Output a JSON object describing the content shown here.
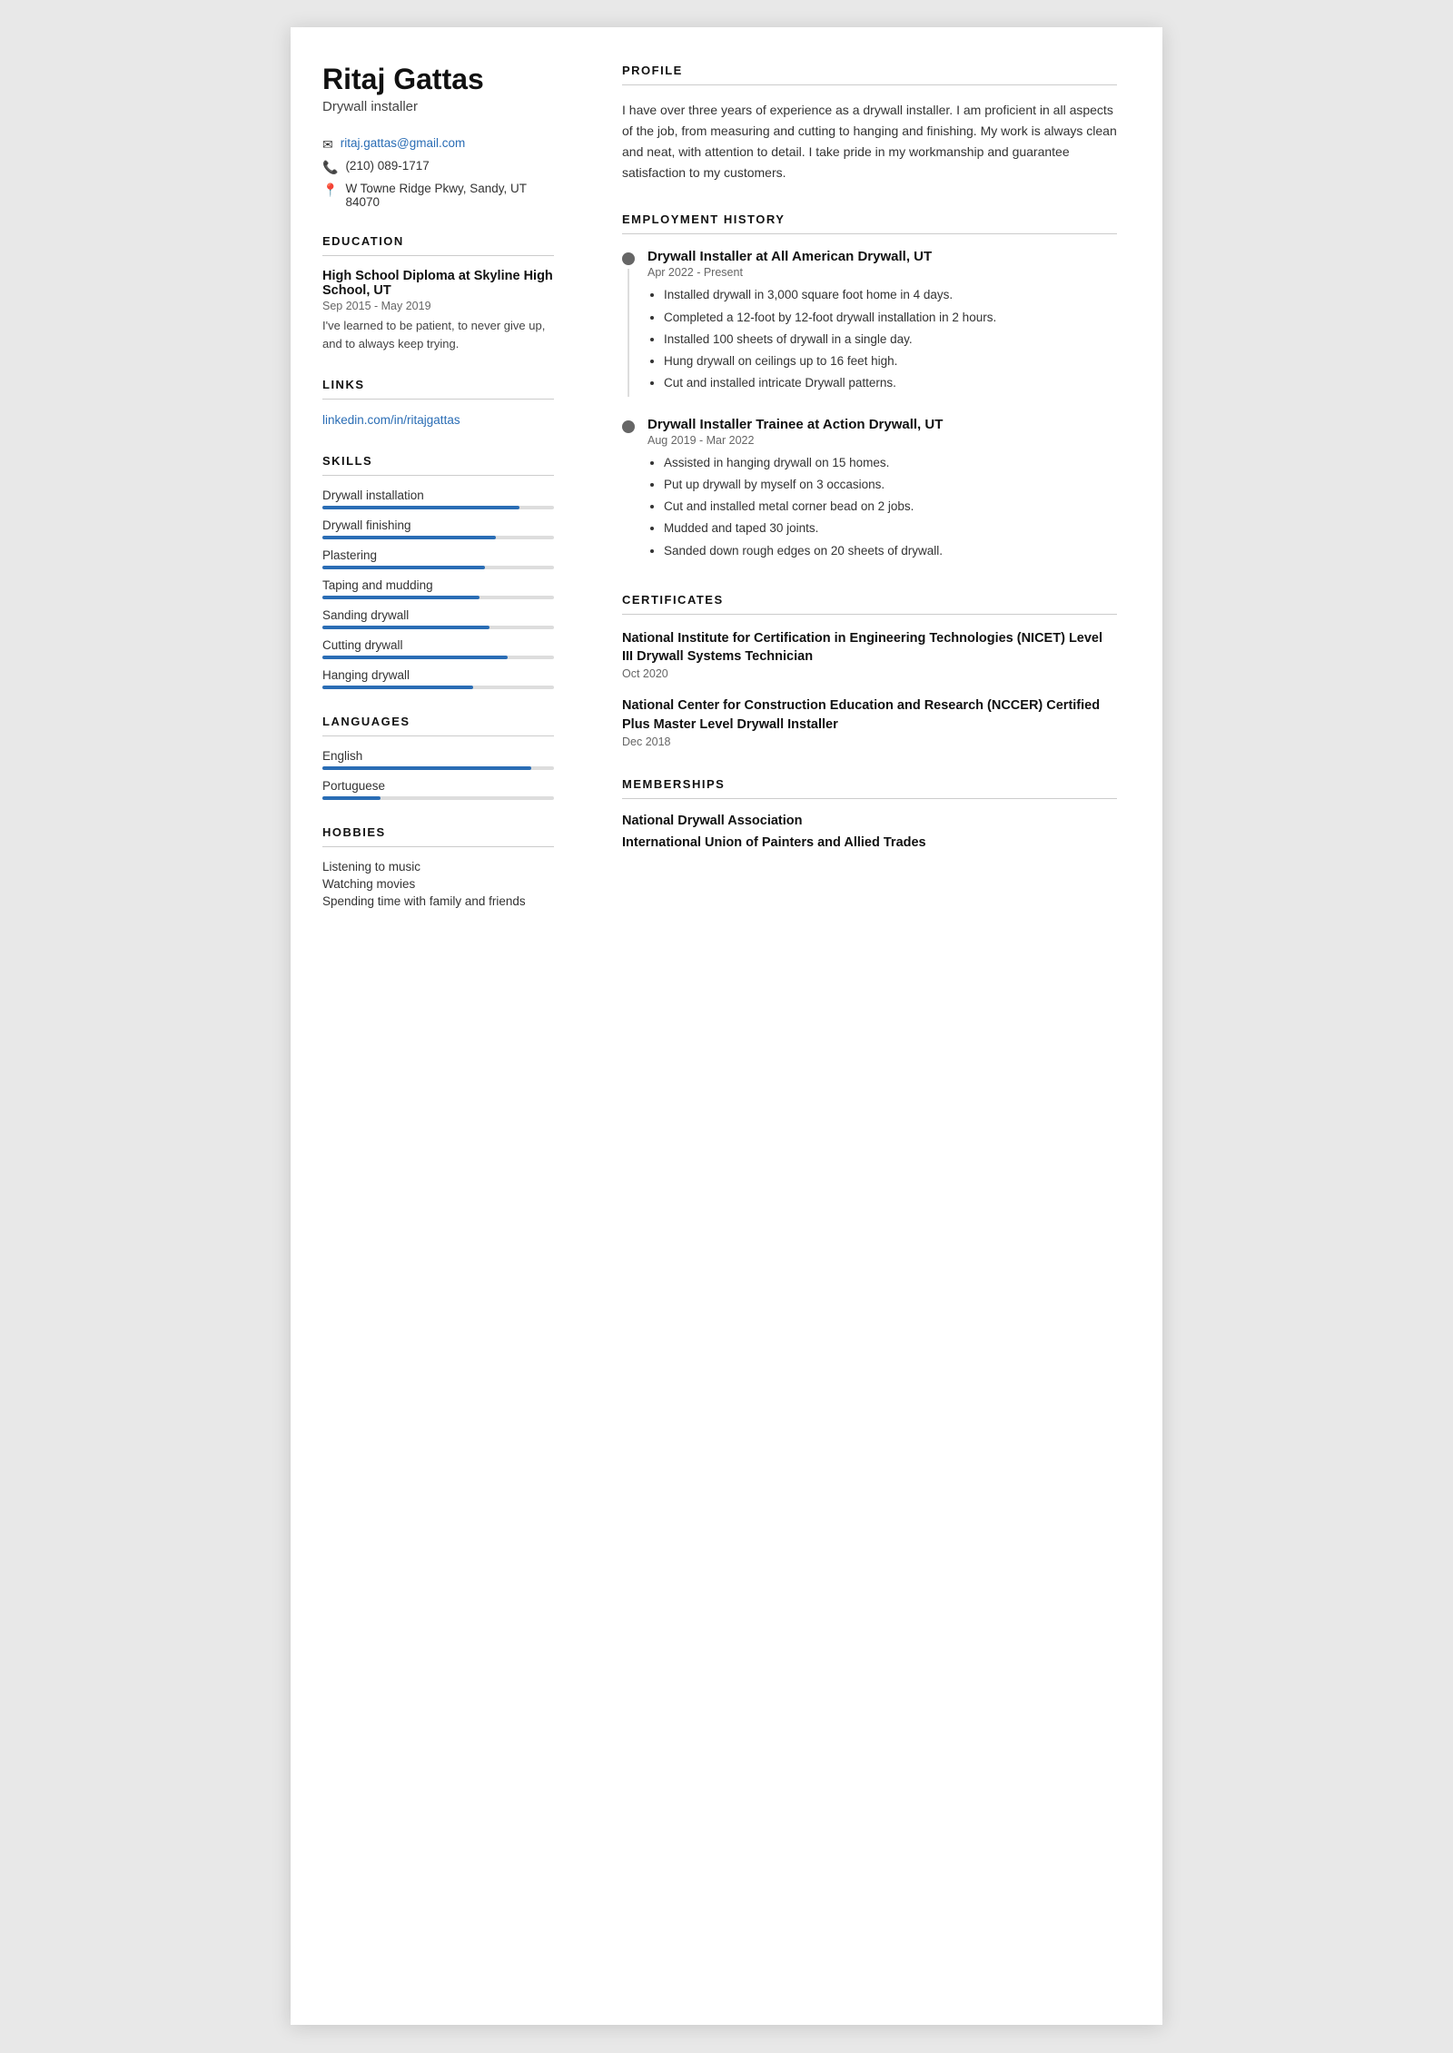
{
  "left": {
    "name": "Ritaj Gattas",
    "title": "Drywall installer",
    "contact": {
      "email": "ritaj.gattas@gmail.com",
      "phone": "(210) 089-1717",
      "address": "W Towne Ridge Pkwy, Sandy, UT 84070"
    },
    "education": {
      "label": "Education",
      "school": "High School Diploma at Skyline High School, UT",
      "dates": "Sep 2015 - May 2019",
      "desc": "I've learned to be patient, to never give up, and to always keep trying."
    },
    "links": {
      "label": "Links",
      "url_text": "linkedin.com/in/ritajgattas",
      "url": "https://linkedin.com/in/ritajgattas"
    },
    "skills": {
      "label": "Skills",
      "items": [
        {
          "name": "Drywall installation",
          "pct": 85
        },
        {
          "name": "Drywall finishing",
          "pct": 75
        },
        {
          "name": "Plastering",
          "pct": 70
        },
        {
          "name": "Taping and mudding",
          "pct": 68
        },
        {
          "name": "Sanding drywall",
          "pct": 72
        },
        {
          "name": "Cutting drywall",
          "pct": 80
        },
        {
          "name": "Hanging drywall",
          "pct": 65
        }
      ]
    },
    "languages": {
      "label": "Languages",
      "items": [
        {
          "name": "English",
          "pct": 90
        },
        {
          "name": "Portuguese",
          "pct": 25
        }
      ]
    },
    "hobbies": {
      "label": "Hobbies",
      "items": [
        "Listening to music",
        "Watching movies",
        "Spending time with family and friends"
      ]
    }
  },
  "right": {
    "profile": {
      "label": "Profile",
      "text": "I have over three years of experience as a drywall installer. I am proficient in all aspects of the job, from measuring and cutting to hanging and finishing. My work is always clean and neat, with attention to detail. I take pride in my workmanship and guarantee satisfaction to my customers."
    },
    "employment": {
      "label": "Employment History",
      "jobs": [
        {
          "title": "Drywall Installer at All American Drywall, UT",
          "dates": "Apr 2022 - Present",
          "bullets": [
            "Installed drywall in 3,000 square foot home in 4 days.",
            "Completed a 12-foot by 12-foot drywall installation in 2 hours.",
            "Installed 100 sheets of drywall in a single day.",
            "Hung drywall on ceilings up to 16 feet high.",
            "Cut and installed intricate Drywall patterns."
          ]
        },
        {
          "title": "Drywall Installer Trainee at Action Drywall, UT",
          "dates": "Aug 2019 - Mar 2022",
          "bullets": [
            "Assisted in hanging drywall on 15 homes.",
            "Put up drywall by myself on 3 occasions.",
            "Cut and installed metal corner bead on 2 jobs.",
            "Mudded and taped 30 joints.",
            "Sanded down rough edges on 20 sheets of drywall."
          ]
        }
      ]
    },
    "certificates": {
      "label": "Certificates",
      "items": [
        {
          "name": "National Institute for Certification in Engineering Technologies (NICET) Level III Drywall Systems Technician",
          "date": "Oct 2020"
        },
        {
          "name": "National Center for Construction Education and Research (NCCER) Certified Plus Master Level Drywall Installer",
          "date": "Dec 2018"
        }
      ]
    },
    "memberships": {
      "label": "Memberships",
      "items": [
        "National Drywall Association",
        "International Union of Painters and Allied Trades"
      ]
    }
  }
}
